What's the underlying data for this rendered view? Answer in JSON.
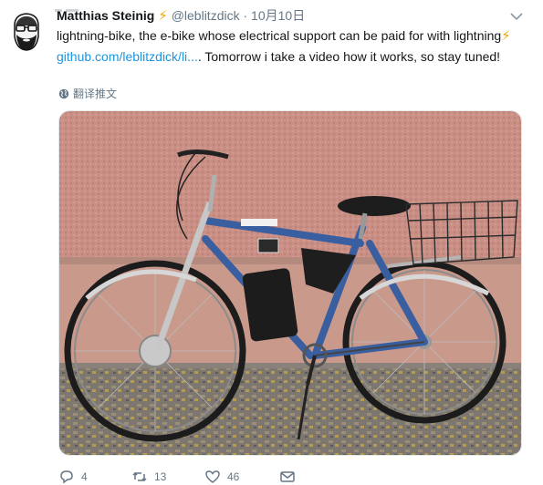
{
  "tweet": {
    "author_name": "Matthias Steinig",
    "handle": "@leblitzdick",
    "dot": "·",
    "date": "10月10日",
    "text_part1": "lightning-bike, the e-bike whose electrical support can be paid for with lightning",
    "link": "github.com/leblitzdick/li...",
    "text_part2": ". Tomorrow i take a video how it works, so stay tuned!",
    "translate_label": "翻译推文",
    "emoji": "⚡"
  },
  "actions": {
    "replies": "4",
    "retweets": "13",
    "likes": "46"
  },
  "colors": {
    "link": "#1b95e0",
    "secondary_text": "#657786",
    "bolt": "#f2a600",
    "bike_blue": "#3a5fa0"
  },
  "icons": {
    "reply": "reply-icon",
    "retweet": "retweet-icon",
    "like": "heart-icon",
    "message": "message-icon",
    "caret": "chevron-down-icon",
    "globe": "globe-icon"
  }
}
